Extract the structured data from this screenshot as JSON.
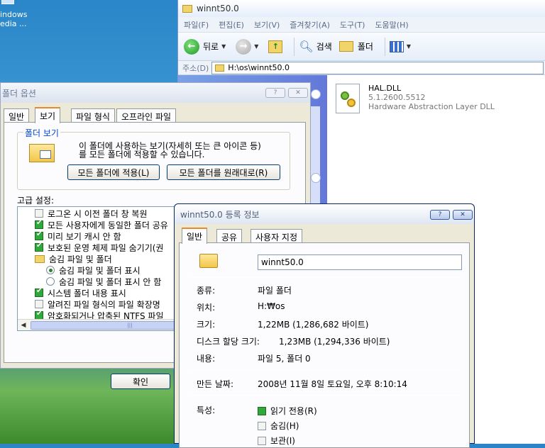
{
  "desktop": {
    "icon_line1": "indows",
    "icon_line2": "edia ..."
  },
  "explorer": {
    "title": "winnt50.0",
    "menu": [
      "파일(F)",
      "편집(E)",
      "보기(V)",
      "즐겨찾기(A)",
      "도구(T)",
      "도움말(H)"
    ],
    "toolbar": {
      "back": "뒤로",
      "search": "검색",
      "folders": "폴더"
    },
    "address_label": "주소(D)",
    "address_value": "H:\\os\\winnt50.0",
    "file": {
      "name": "HAL.DLL",
      "version": "5.1.2600.5512",
      "description": "Hardware Abstraction Layer DLL"
    }
  },
  "folder_options": {
    "title": "폴더 옵션",
    "tabs": [
      "일반",
      "보기",
      "파일 형식",
      "오프라인 파일"
    ],
    "group_label": "폴더 보기",
    "group_text1": "이 폴더에 사용하는 보기(자세히 또는 큰 아이콘 등)",
    "group_text2": "를 모든 폴더에 적용할 수 있습니다.",
    "apply_all": "모든 폴더에 적용(L)",
    "reset_all": "모든 폴더를 원래대로(R)",
    "advanced_label": "고급 설정:",
    "settings": [
      {
        "label": "로그온 시 이전 폴더 창 복원",
        "type": "checkbox",
        "checked": false
      },
      {
        "label": "모든 사용자에게 동일한 폴더 공유",
        "type": "checkbox",
        "checked": true
      },
      {
        "label": "미리 보기 캐시 안 함",
        "type": "checkbox",
        "checked": true
      },
      {
        "label": "보호된 운영 체제 파일 숨기기(권",
        "type": "checkbox",
        "checked": true
      },
      {
        "label": "숨김 파일 및 폴더",
        "type": "folder",
        "checked": false
      },
      {
        "label": "숨김 파일 및 폴더 표시",
        "type": "radio",
        "checked": true
      },
      {
        "label": "숨김 파일 및 폴더 표시 안 함",
        "type": "radio",
        "checked": false
      },
      {
        "label": "시스템 폴더 내용 표시",
        "type": "checkbox",
        "checked": true
      },
      {
        "label": "알려진 파일 형식의 파일 확장명",
        "type": "checkbox",
        "checked": false
      },
      {
        "label": "암호화되거나 압축된 NTFS 파일",
        "type": "checkbox",
        "checked": true
      }
    ],
    "ok_button": "확인"
  },
  "properties": {
    "title": "winnt50.0 등록 정보",
    "tabs": [
      "일반",
      "공유",
      "사용자 지정"
    ],
    "name": "winnt50.0",
    "type_label": "종류:",
    "type_value": "파일 폴더",
    "location_label": "위치:",
    "location_value": "H:₩os",
    "size_label": "크기:",
    "size_value": "1,22MB (1,286,682 바이트)",
    "disk_label": "디스크 할당 크기:",
    "disk_value": "1,23MB (1,294,336 바이트)",
    "contents_label": "내용:",
    "contents_value": "파일 5, 폴더 0",
    "created_label": "만든 날짜:",
    "created_value": "2008년 11월 8일 토요일, 오후 8:10:14",
    "attributes_label": "특성:",
    "attributes": [
      {
        "label": "읽기 전용(R)",
        "state": "indeterminate"
      },
      {
        "label": "숨김(H)",
        "state": "unchecked"
      },
      {
        "label": "보관(I)",
        "state": "unchecked"
      }
    ]
  }
}
